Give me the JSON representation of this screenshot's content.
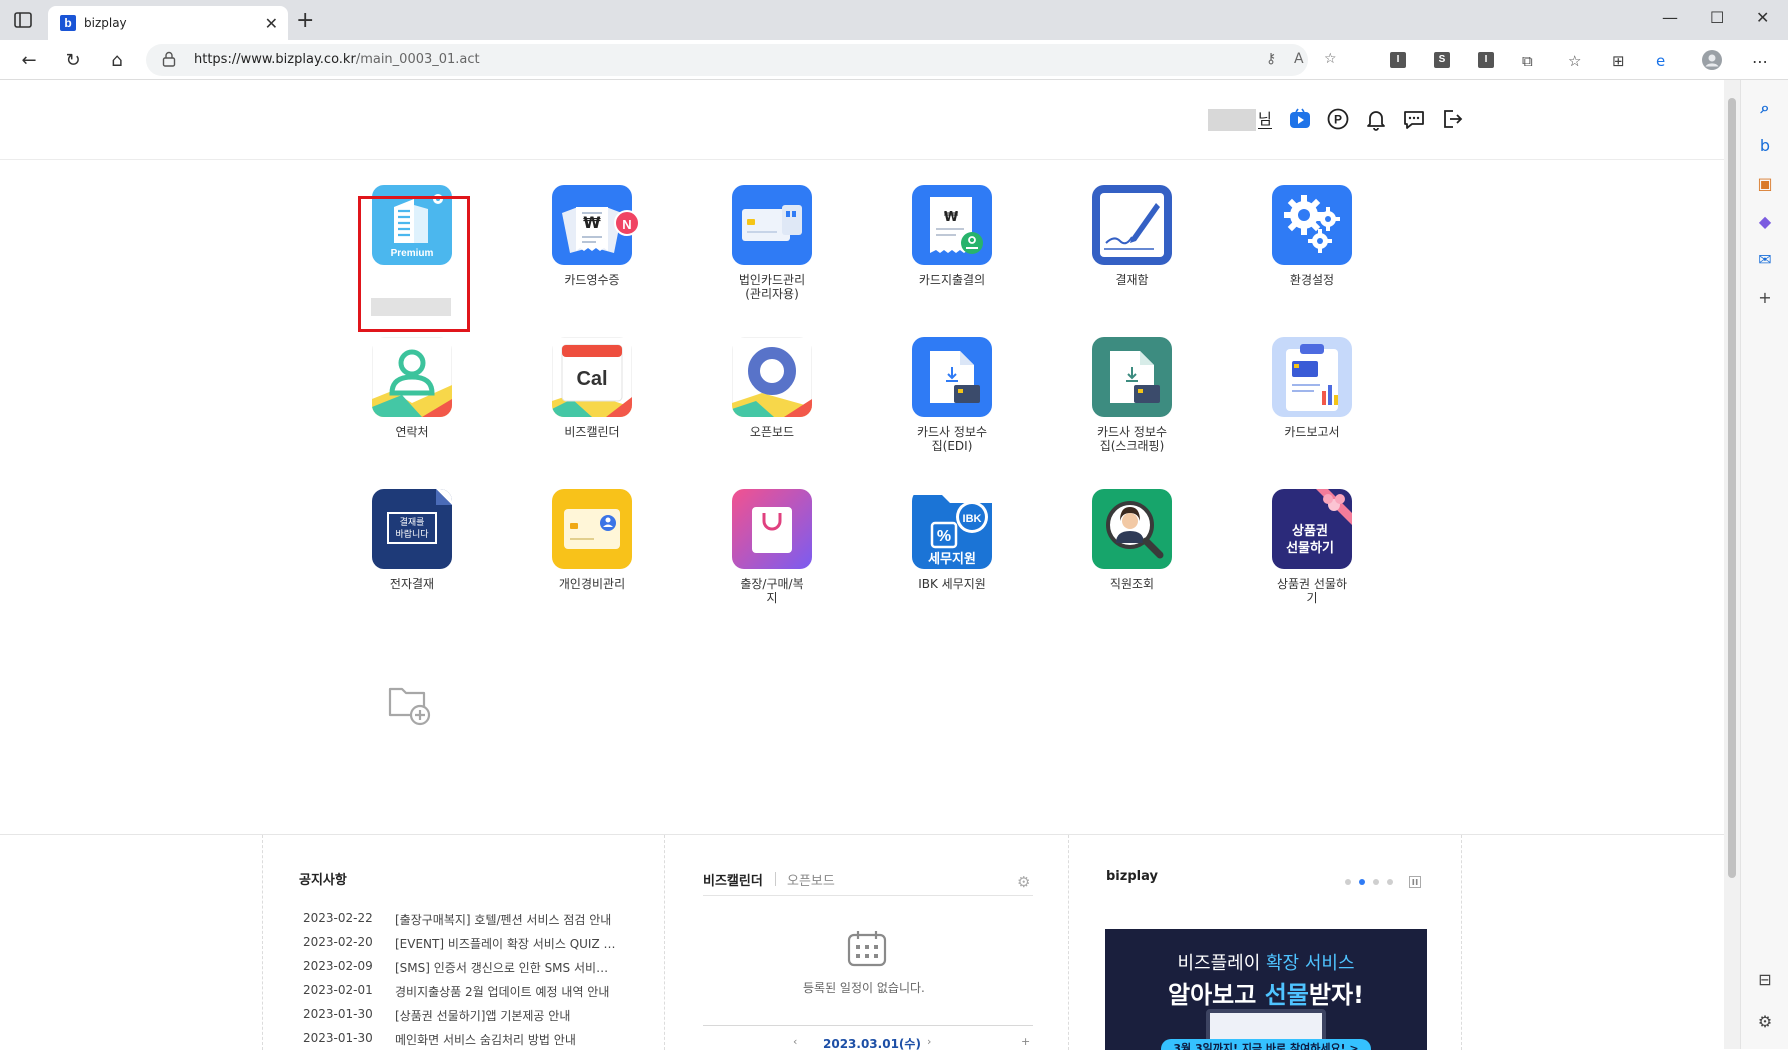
{
  "browser": {
    "tab_title": "bizplay",
    "url_host": "https://www.bizplay.co.kr",
    "url_path": "/main_0003_01.act"
  },
  "header": {
    "user_suffix": "님"
  },
  "apps": [
    {
      "label": "",
      "name": "premium-app"
    },
    {
      "label": "카드영수증",
      "name": "card-receipt-app"
    },
    {
      "label": "법인카드관리\n(관리자용)",
      "name": "corporate-card-admin-app"
    },
    {
      "label": "카드지출결의",
      "name": "card-expense-approval-app"
    },
    {
      "label": "결재함",
      "name": "approval-box-app"
    },
    {
      "label": "환경설정",
      "name": "settings-app"
    },
    {
      "label": "연락처",
      "name": "contacts-app"
    },
    {
      "label": "비즈캘린더",
      "name": "biz-calendar-app"
    },
    {
      "label": "오픈보드",
      "name": "openboard-app"
    },
    {
      "label": "카드사 정보수\n집(EDI)",
      "name": "card-info-edi-app"
    },
    {
      "label": "카드사 정보수\n집(스크래핑)",
      "name": "card-info-scraping-app"
    },
    {
      "label": "카드보고서",
      "name": "card-report-app"
    },
    {
      "label": "전자결재",
      "name": "e-approval-app"
    },
    {
      "label": "개인경비관리",
      "name": "personal-expense-app"
    },
    {
      "label": "출장/구매/복\n지",
      "name": "travel-purchase-welfare-app"
    },
    {
      "label": "IBK 세무지원",
      "name": "ibk-tax-support-app"
    },
    {
      "label": "직원조회",
      "name": "employee-lookup-app"
    },
    {
      "label": "상품권 선물하\n기",
      "name": "gift-card-app"
    }
  ],
  "icon_texts": {
    "premium": "Premium",
    "cal": "Cal",
    "eapproval": "결재를\n바랍니다",
    "ibk": "IBK",
    "tax": "세무지원",
    "gift": "상품권\n선물하기",
    "badge_new": "N",
    "won": "₩"
  },
  "notice": {
    "title": "공지사항",
    "items": [
      {
        "date": "2023-02-22",
        "text": "[출장구매복지] 호텔/펜션 서비스 점검 안내"
      },
      {
        "date": "2023-02-20",
        "text": "[EVENT] 비즈플레이 확장 서비스 QUIZ 이벤트"
      },
      {
        "date": "2023-02-09",
        "text": "[SMS] 인증서 갱신으로 인한 SMS 서비스 안내"
      },
      {
        "date": "2023-02-01",
        "text": "경비지출상품 2월 업데이트 예정 내역 안내"
      },
      {
        "date": "2023-01-30",
        "text": "[상품권 선물하기]앱 기본제공 안내"
      },
      {
        "date": "2023-01-30",
        "text": "메인화면 서비스 숨김처리 방법 안내"
      }
    ]
  },
  "calendar_panel": {
    "tab_active": "비즈캘린더",
    "tab_inactive": "오픈보드",
    "empty_message": "등록된 일정이 없습니다.",
    "date": "2023.03.01(수)"
  },
  "banner_panel": {
    "title": "bizplay",
    "line1_a": "비즈플레이 ",
    "line1_b": "확장 서비스",
    "line2_a": "알아보고 ",
    "line2_b": "선물",
    "line2_c": "받자!",
    "cta": "3월 3일까지! 지금 바로 참여하세요! >",
    "active_dot": 1,
    "dot_count": 4
  }
}
